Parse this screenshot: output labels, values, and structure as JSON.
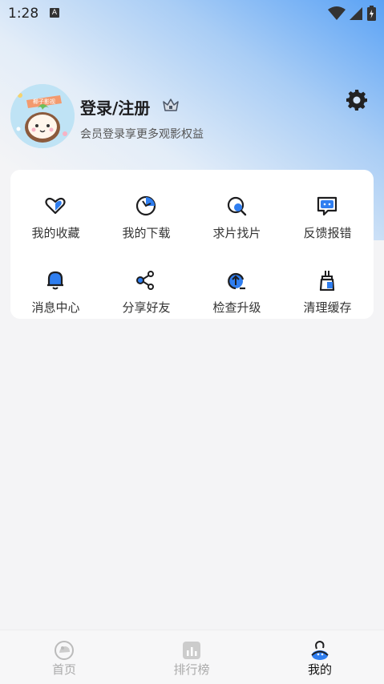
{
  "status_bar": {
    "time": "1:28",
    "notif_letter": "A"
  },
  "profile": {
    "login_label": "登录/注册",
    "subtitle": "会员登录享更多观影权益",
    "avatar_banner": "椰子影视"
  },
  "menu": {
    "row1": [
      {
        "label": "我的收藏",
        "icon": "heart-icon"
      },
      {
        "label": "我的下载",
        "icon": "download-icon"
      },
      {
        "label": "求片找片",
        "icon": "search-film-icon"
      },
      {
        "label": "反馈报错",
        "icon": "feedback-icon"
      }
    ],
    "row2": [
      {
        "label": "消息中心",
        "icon": "bell-icon"
      },
      {
        "label": "分享好友",
        "icon": "share-icon"
      },
      {
        "label": "检查升级",
        "icon": "upgrade-icon"
      },
      {
        "label": "清理缓存",
        "icon": "broom-icon"
      }
    ]
  },
  "tabbar": {
    "tabs": [
      {
        "label": "首页",
        "icon": "home-icon"
      },
      {
        "label": "排行榜",
        "icon": "ranking-icon"
      },
      {
        "label": "我的",
        "icon": "profile-icon",
        "active": true
      }
    ]
  },
  "colors": {
    "accent": "#2f7ef0",
    "text_dark": "#1d1d1f"
  }
}
